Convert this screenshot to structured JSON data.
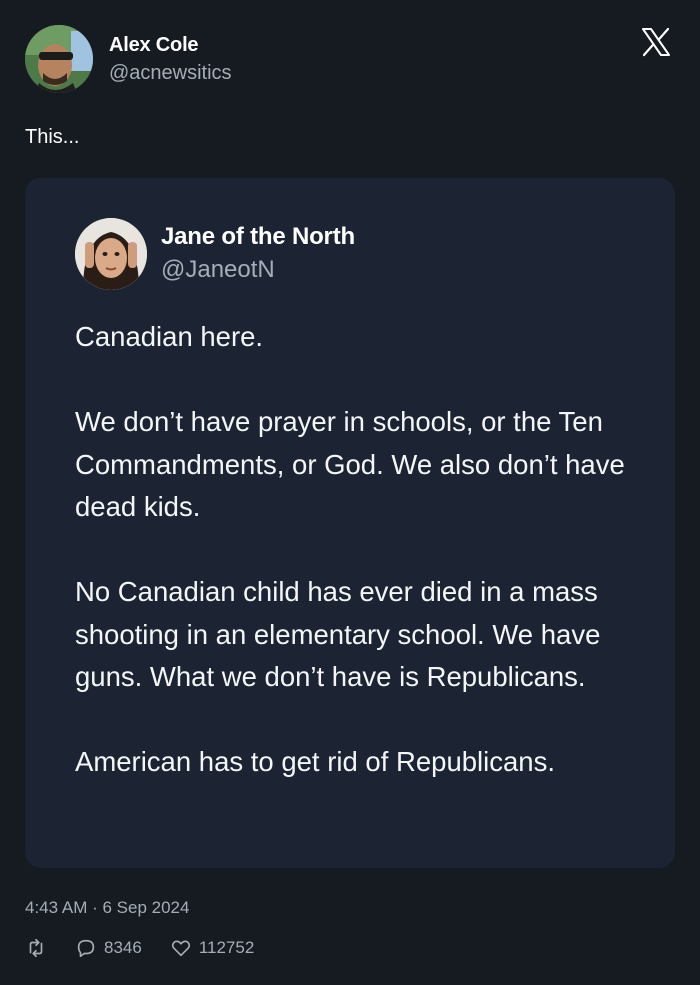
{
  "author": {
    "name": "Alex Cole",
    "handle": "@acnewsitics"
  },
  "tweet": {
    "text": "This..."
  },
  "quoted": {
    "name": "Jane of the North",
    "handle": "@JaneotN",
    "paragraphs": [
      "Canadian here.",
      "We don’t have prayer in schools, or the Ten Commandments, or God. We also don’t have dead kids.",
      "No Canadian child has ever died in a mass shooting in an elementary school. We have guns. What we don’t have is Republicans.",
      "American has to get rid of Republicans."
    ]
  },
  "meta": {
    "timestamp": "4:43 AM · 6 Sep 2024"
  },
  "actions": {
    "replies": "8346",
    "likes": "112752"
  },
  "icons": {
    "brand": "x-logo-icon",
    "retweet": "retweet-icon",
    "reply": "reply-icon",
    "like": "heart-icon"
  }
}
